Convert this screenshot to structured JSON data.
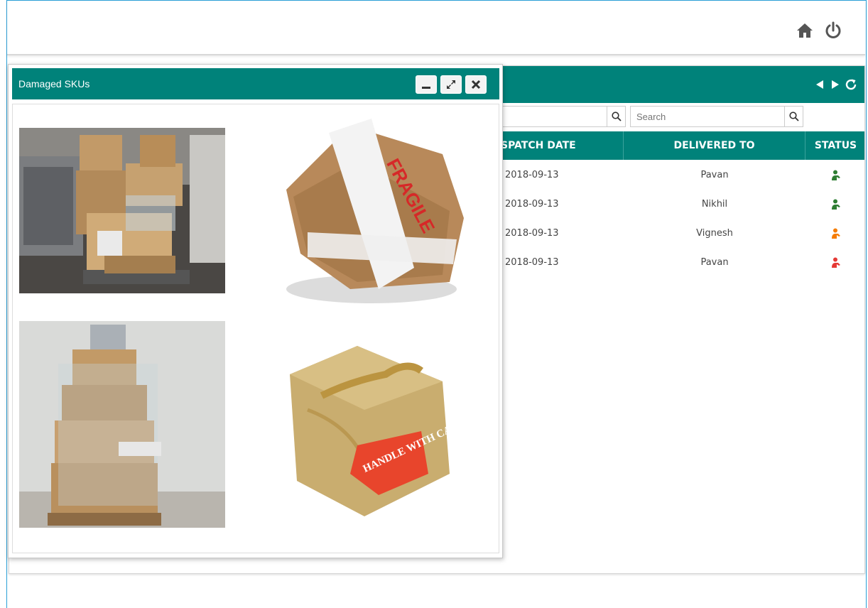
{
  "modal": {
    "title": "Damaged SKUs"
  },
  "table": {
    "search_placeholder": "Search",
    "columns": {
      "dispatch_date": "SPATCH DATE",
      "delivered_to": "DELIVERED TO",
      "status": "STATUS"
    },
    "rows": [
      {
        "dispatch_date": "2018-09-13",
        "delivered_to": "Pavan",
        "status_color": "#2e7d32"
      },
      {
        "dispatch_date": "2018-09-13",
        "delivered_to": "Nikhil",
        "status_color": "#2e7d32"
      },
      {
        "dispatch_date": "2018-09-13",
        "delivered_to": "Vignesh",
        "status_color": "#f57c00"
      },
      {
        "dispatch_date": "2018-09-13",
        "delivered_to": "Pavan",
        "status_color": "#e53935"
      }
    ]
  },
  "images": {
    "img3_label": "HANDLE WITH CARE",
    "fragile_label": "FRAGILE"
  },
  "colors": {
    "accent": "#00827a",
    "frame_border": "#2a9fd6"
  }
}
